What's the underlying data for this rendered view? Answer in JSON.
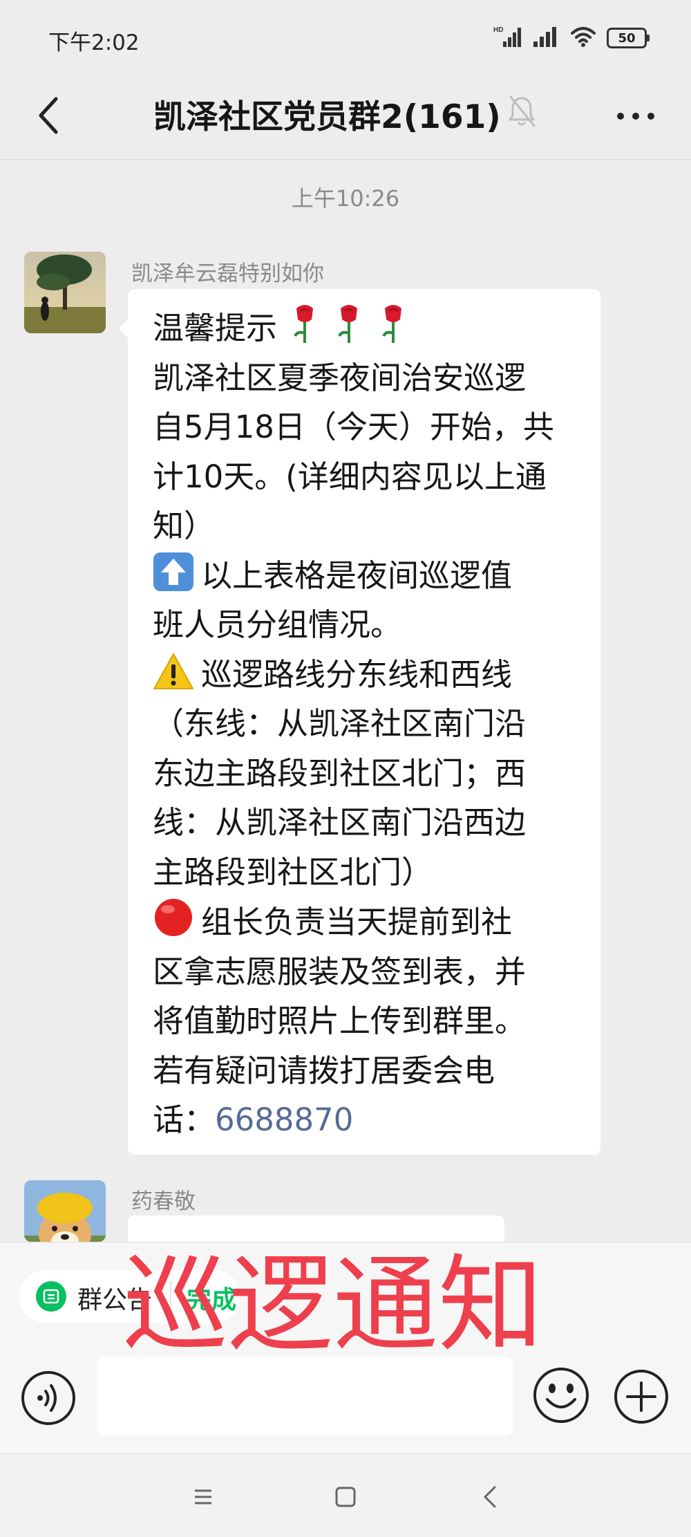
{
  "status_bar": {
    "time": "下午2:02",
    "hd_label": "HD",
    "battery": "50"
  },
  "header": {
    "title": "凯泽社区党员群2(161)"
  },
  "timestamp": "上午10:26",
  "messages": [
    {
      "sender": "凯泽牟云磊特别如你",
      "lines": [
        "温馨提示",
        "凯泽社区夏季夜间治安巡逻",
        "自5月18日（今天）开始，共",
        "计10天。(详细内容见以上通",
        "知）",
        "以上表格是夜间巡逻值",
        "班人员分组情况。",
        "巡逻路线分东线和西线",
        "（东线：从凯泽社区南门沿",
        "东边主路段到社区北门；西",
        "线：从凯泽社区南门沿西边",
        "主路段到社区北门）",
        "组长负责当天提前到社",
        "区拿志愿服装及签到表，并",
        "将值勤时照片上传到群里。",
        "若有疑问请拨打居委会电",
        "话："
      ],
      "phone": "6688870"
    },
    {
      "sender": "药春敬"
    }
  ],
  "notice_bar": {
    "label": "群公告",
    "done": "完成"
  },
  "overlay_caption": "巡逻通知",
  "input": {
    "value": ""
  },
  "colors": {
    "accent_green": "#07c160",
    "link_blue": "#576b95",
    "caption_red": "#ee3f4d",
    "chat_bg": "#ededed"
  }
}
